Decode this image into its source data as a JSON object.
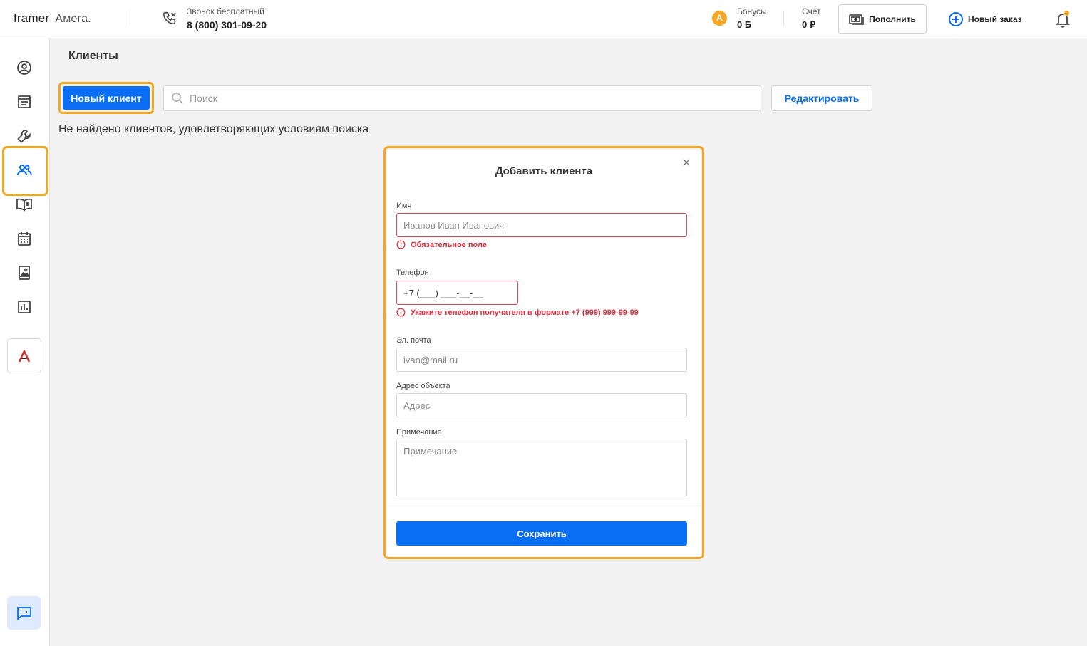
{
  "header": {
    "brand": "framer",
    "brand_sub": "Амега.",
    "call_label": "Звонок бесплатный",
    "call_number": "8 (800) 301-09-20",
    "bonus_icon_letter": "A",
    "bonus_label": "Бонусы",
    "bonus_value": "0 Б",
    "account_label": "Счет",
    "account_value": "0 ₽",
    "topup_label": "Пополнить",
    "new_order_label": "Новый заказ"
  },
  "sidebar": {
    "items": [
      {
        "icon": "user-circle-icon"
      },
      {
        "icon": "document-icon"
      },
      {
        "icon": "wrench-icon"
      },
      {
        "icon": "clients-icon",
        "active": true
      },
      {
        "icon": "book-icon"
      },
      {
        "icon": "calendar-icon"
      },
      {
        "icon": "gallery-icon"
      },
      {
        "icon": "chart-icon"
      }
    ],
    "brand_letter": "A"
  },
  "main": {
    "title": "Клиенты",
    "new_client_label": "Новый клиент",
    "search_placeholder": "Поиск",
    "edit_label": "Редактировать",
    "empty_message": "Не найдено клиентов, удовлетворяющих условиям поиска"
  },
  "modal": {
    "title": "Добавить клиента",
    "name_label": "Имя",
    "name_placeholder": "Иванов Иван Иванович",
    "name_error": "Обязательное поле",
    "phone_label": "Телефон",
    "phone_value": "+7 (___) ___-__-__",
    "phone_error": "Укажите телефон получателя в формате +7 (999) 999-99-99",
    "email_label": "Эл. почта",
    "email_placeholder": "ivan@mail.ru",
    "address_label": "Адрес объекта",
    "address_placeholder": "Адрес",
    "note_label": "Примечание",
    "note_placeholder": "Примечание",
    "save_label": "Сохранить"
  },
  "colors": {
    "accent": "#0a6ef5",
    "highlight": "#f5a623",
    "error": "#d92f3c"
  }
}
